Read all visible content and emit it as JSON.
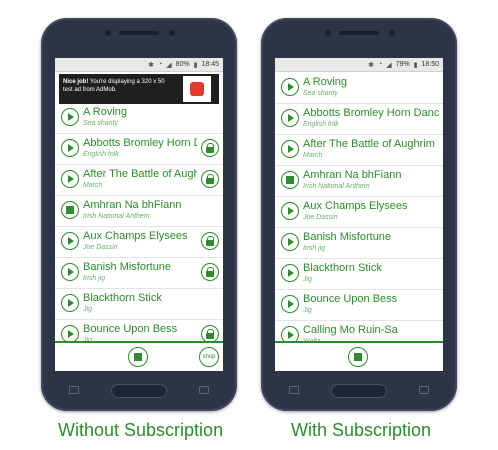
{
  "left_phone": {
    "status": {
      "battery": "80%",
      "time": "18:45"
    },
    "ad": {
      "bold": "Nice job!",
      "text": " You're displaying a 320 x 50 test ad from AdMob."
    },
    "songs": [
      {
        "title": "A Roving",
        "subtitle": "Sea shanty",
        "state": "play",
        "locked": false
      },
      {
        "title": "Abbotts Bromley Horn Dance",
        "subtitle": "English folk",
        "state": "play",
        "locked": true
      },
      {
        "title": "After The Battle of Aughrim",
        "subtitle": "March",
        "state": "play",
        "locked": true
      },
      {
        "title": "Amhran Na bhFiann",
        "subtitle": "Irish National Anthem",
        "state": "stop",
        "locked": false
      },
      {
        "title": "Aux Champs Elysees",
        "subtitle": "Joe Dassin",
        "state": "play",
        "locked": true
      },
      {
        "title": "Banish Misfortune",
        "subtitle": "Irish jig",
        "state": "play",
        "locked": true
      },
      {
        "title": "Blackthorn Stick",
        "subtitle": "Jig",
        "state": "play",
        "locked": false
      },
      {
        "title": "Bounce Upon Bess",
        "subtitle": "Jig",
        "state": "play",
        "locked": true
      }
    ],
    "shop_label": "shop"
  },
  "right_phone": {
    "status": {
      "battery": "79%",
      "time": "18:50"
    },
    "songs": [
      {
        "title": "A Roving",
        "subtitle": "Sea shanty",
        "state": "play"
      },
      {
        "title": "Abbotts Bromley Horn Dance",
        "subtitle": "English folk",
        "state": "play"
      },
      {
        "title": "After The Battle of Aughrim",
        "subtitle": "March",
        "state": "play"
      },
      {
        "title": "Amhran Na bhFiann",
        "subtitle": "Irish National Anthem",
        "state": "stop"
      },
      {
        "title": "Aux Champs Elysees",
        "subtitle": "Joe Dassin",
        "state": "play"
      },
      {
        "title": "Banish Misfortune",
        "subtitle": "Irish jig",
        "state": "play"
      },
      {
        "title": "Blackthorn Stick",
        "subtitle": "Jig",
        "state": "play"
      },
      {
        "title": "Bounce Upon Bess",
        "subtitle": "Jig",
        "state": "play"
      },
      {
        "title": "Calling Mo Ruin-Sa",
        "subtitle": "Waltz",
        "state": "play"
      }
    ]
  },
  "captions": {
    "left": "Without Subscription",
    "right": "With Subscription"
  },
  "colors": {
    "accent": "#2e8b2e",
    "phone_body": "#2c3446"
  }
}
